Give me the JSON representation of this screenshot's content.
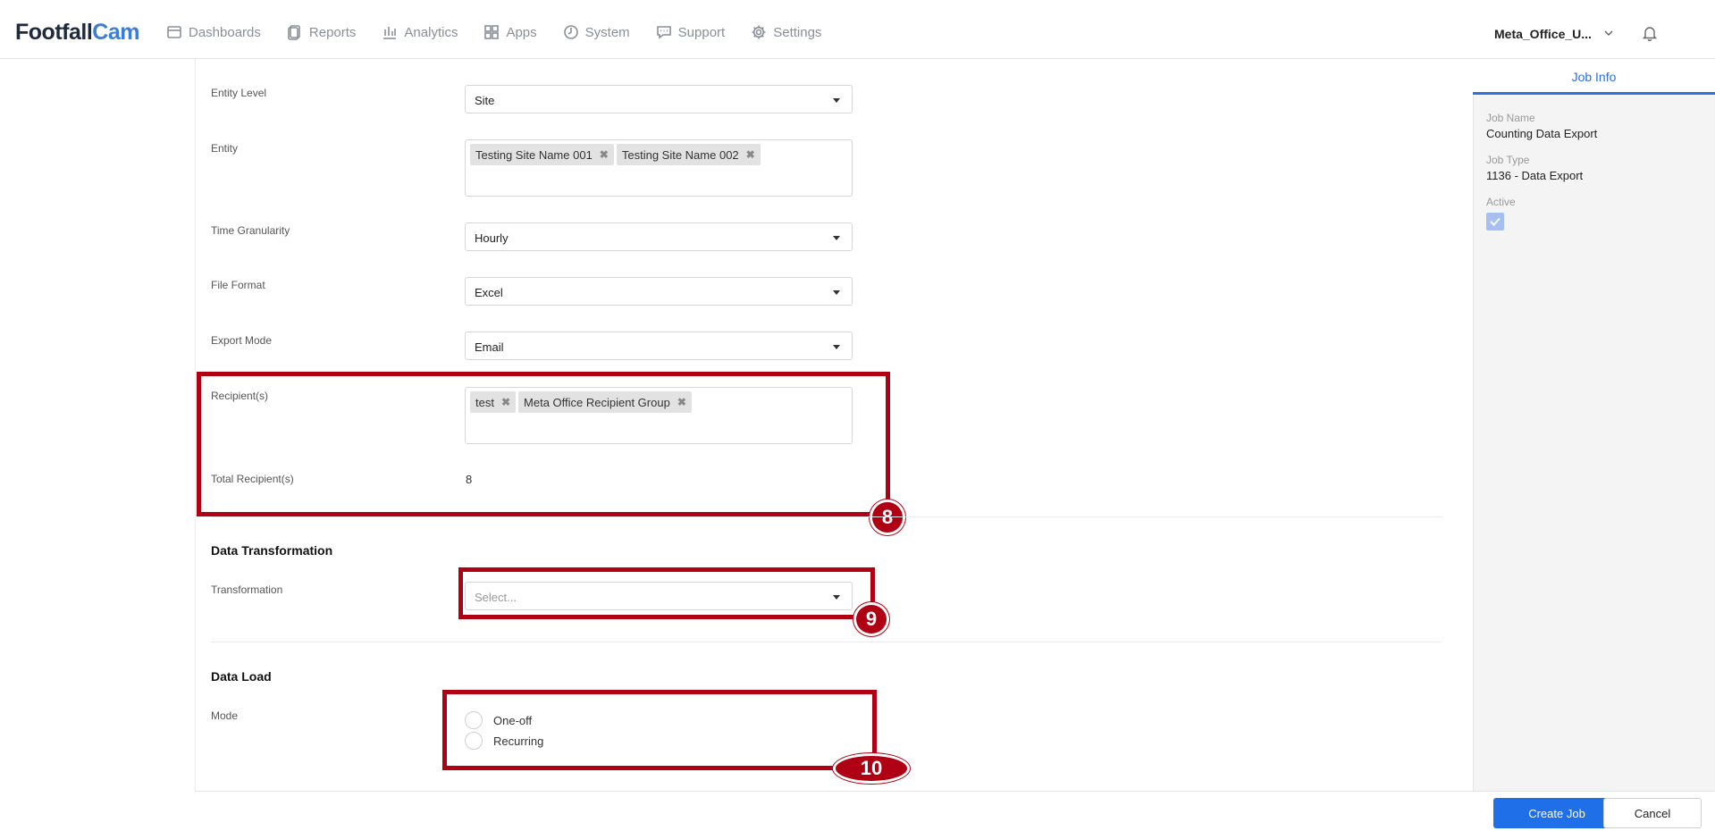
{
  "brand": {
    "part1": "Footfall",
    "part2": "Cam"
  },
  "nav": [
    {
      "label": "Dashboards",
      "icon": "dashboard-icon"
    },
    {
      "label": "Reports",
      "icon": "reports-icon"
    },
    {
      "label": "Analytics",
      "icon": "analytics-icon"
    },
    {
      "label": "Apps",
      "icon": "apps-icon"
    },
    {
      "label": "System",
      "icon": "system-icon"
    },
    {
      "label": "Support",
      "icon": "support-icon"
    },
    {
      "label": "Settings",
      "icon": "gear-icon"
    }
  ],
  "user": {
    "name": "Meta_Office_U..."
  },
  "form": {
    "entity_level": {
      "label": "Entity Level",
      "value": "Site"
    },
    "entity": {
      "label": "Entity",
      "tags": [
        "Testing Site Name 001",
        "Testing Site Name 002"
      ]
    },
    "time_granularity": {
      "label": "Time Granularity",
      "value": "Hourly"
    },
    "file_format": {
      "label": "File Format",
      "value": "Excel"
    },
    "export_mode": {
      "label": "Export Mode",
      "value": "Email"
    },
    "recipients": {
      "label": "Recipient(s)",
      "tags": [
        "test",
        "Meta Office Recipient Group"
      ]
    },
    "total_recipients": {
      "label": "Total Recipient(s)",
      "value": "8"
    }
  },
  "transformation": {
    "section_title": "Data Transformation",
    "label": "Transformation",
    "placeholder": "Select..."
  },
  "data_load": {
    "section_title": "Data Load",
    "label": "Mode",
    "options": [
      "One-off",
      "Recurring"
    ]
  },
  "annotations": {
    "a8": "8",
    "a9": "9",
    "a10": "10",
    "color": "#b00014"
  },
  "job_info": {
    "tab": "Job Info",
    "job_name_label": "Job Name",
    "job_name": "Counting Data Export",
    "job_type_label": "Job Type",
    "job_type": "1136 - Data Export",
    "active_label": "Active"
  },
  "footer": {
    "create": "Create Job",
    "cancel": "Cancel"
  }
}
